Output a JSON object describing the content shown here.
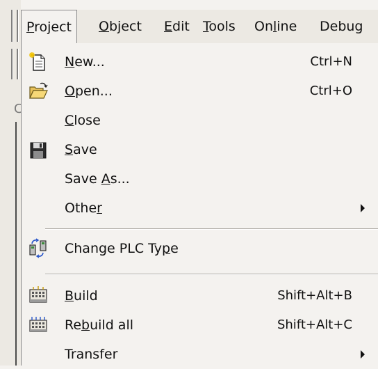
{
  "menubar": {
    "items": [
      {
        "pre": "",
        "mn": "P",
        "post": "roject"
      },
      {
        "pre": "",
        "mn": "O",
        "post": "bject"
      },
      {
        "pre": "",
        "mn": "E",
        "post": "dit"
      },
      {
        "pre": "",
        "mn": "T",
        "post": "ools"
      },
      {
        "pre": "On",
        "mn": "l",
        "post": "ine"
      },
      {
        "pre": "Debug",
        "mn": "",
        "post": ""
      }
    ]
  },
  "project_menu": {
    "items": [
      {
        "icon": "new-document-icon",
        "pre": "",
        "mn": "N",
        "post": "ew...",
        "shortcut": "Ctrl+N"
      },
      {
        "icon": "open-folder-icon",
        "pre": "",
        "mn": "O",
        "post": "pen...",
        "shortcut": "Ctrl+O"
      },
      {
        "icon": "",
        "pre": "",
        "mn": "C",
        "post": "lose",
        "shortcut": ""
      },
      {
        "icon": "save-disk-icon",
        "pre": "",
        "mn": "S",
        "post": "ave",
        "shortcut": ""
      },
      {
        "icon": "",
        "pre": "Save ",
        "mn": "A",
        "post": "s...",
        "shortcut": ""
      },
      {
        "icon": "",
        "pre": "Othe",
        "mn": "r",
        "post": "",
        "shortcut": "",
        "submenu": true
      },
      {
        "icon": "change-plc-type-icon",
        "pre": "Change PLC Ty",
        "mn": "p",
        "post": "e",
        "shortcut": ""
      },
      {
        "icon": "build-icon",
        "pre": "",
        "mn": "B",
        "post": "uild",
        "shortcut": "Shift+Alt+B"
      },
      {
        "icon": "rebuild-all-icon",
        "pre": "Re",
        "mn": "b",
        "post": "uild all",
        "shortcut": "Shift+Alt+C"
      },
      {
        "icon": "",
        "pre": "Transfer",
        "mn": "",
        "post": "",
        "shortcut": "",
        "submenu": true
      }
    ]
  },
  "background": {
    "fragment": "C"
  }
}
